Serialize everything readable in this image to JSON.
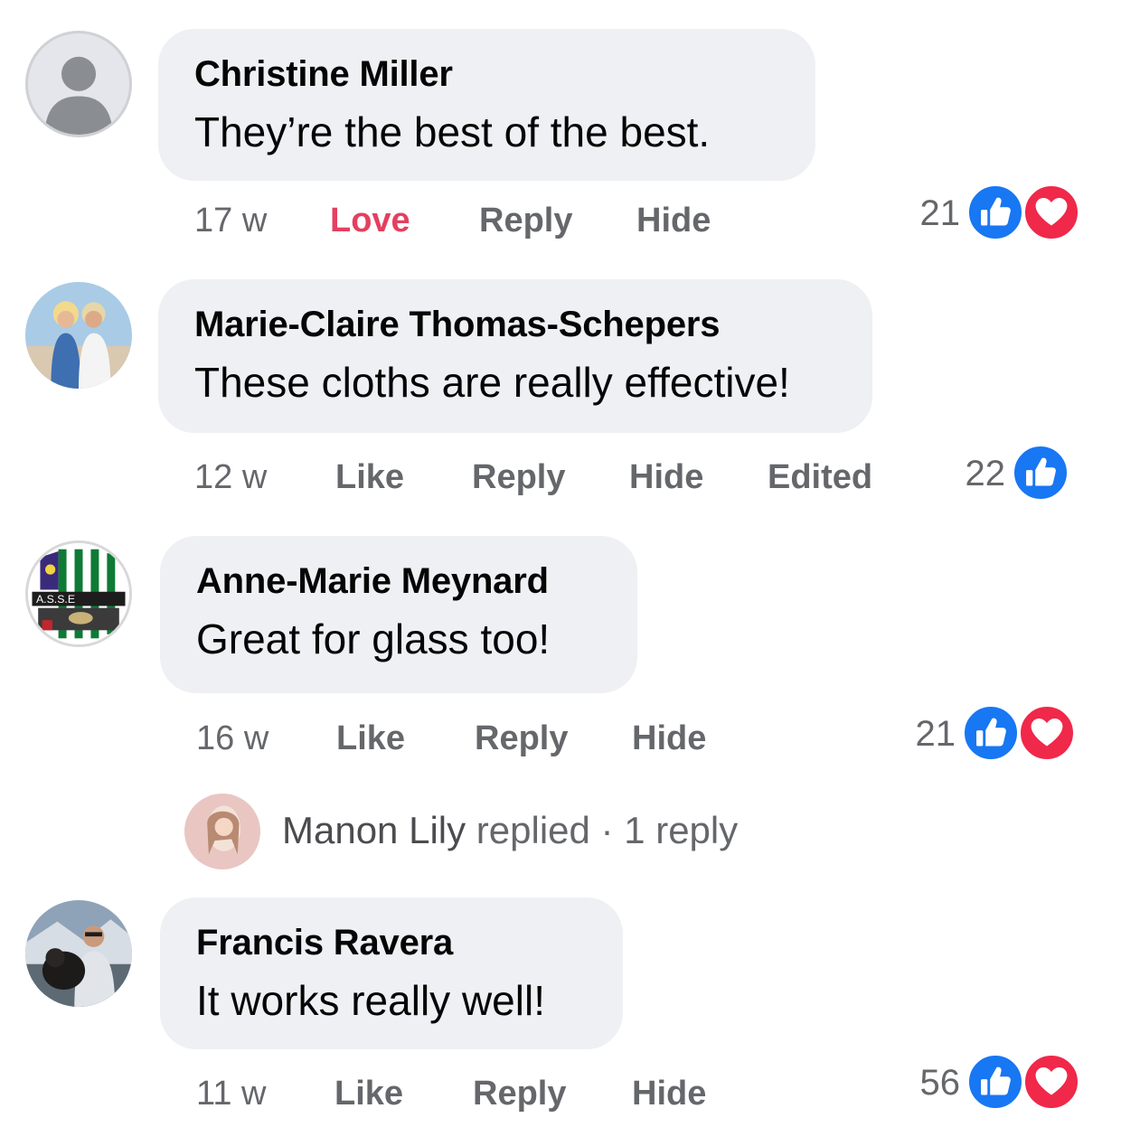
{
  "comments": [
    {
      "author": "Christine Miller",
      "text": "They’re the best of the best.",
      "time": "17 w",
      "like_label": "Love",
      "reply_label": "Reply",
      "hide_label": "Hide",
      "reaction_count": "21",
      "reactions": [
        "like-icon",
        "love-icon"
      ],
      "avatar": "default-profile-icon"
    },
    {
      "author": "Marie-Claire Thomas-Schepers",
      "text": "These cloths are really effective!",
      "time": "12 w",
      "like_label": "Like",
      "reply_label": "Reply",
      "hide_label": "Hide",
      "edited_label": "Edited",
      "reaction_count": "22",
      "reactions": [
        "like-icon"
      ],
      "avatar": "couple-photo"
    },
    {
      "author": "Anne-Marie Meynard",
      "text": "Great for glass too!",
      "time": "16 w",
      "like_label": "Like",
      "reply_label": "Reply",
      "hide_label": "Hide",
      "reaction_count": "21",
      "reactions": [
        "like-icon",
        "love-icon"
      ],
      "avatar": "club-crest",
      "avatar_text": "A.S.S.E",
      "replies_preview": {
        "name": "Manon Lily",
        "text": "replied · 1 reply"
      }
    },
    {
      "author": "Francis Ravera",
      "text": "It works really well!",
      "time": "11 w",
      "like_label": "Like",
      "reply_label": "Reply",
      "hide_label": "Hide",
      "reaction_count": "56",
      "reactions": [
        "like-icon",
        "love-icon"
      ],
      "avatar": "man-with-dog-photo"
    }
  ],
  "colors": {
    "bubble": "#eff0f3",
    "secondary_text": "#65676b",
    "love_text": "#e4405f",
    "like_blue": "#1877f2",
    "love_red": "#f0284a"
  }
}
